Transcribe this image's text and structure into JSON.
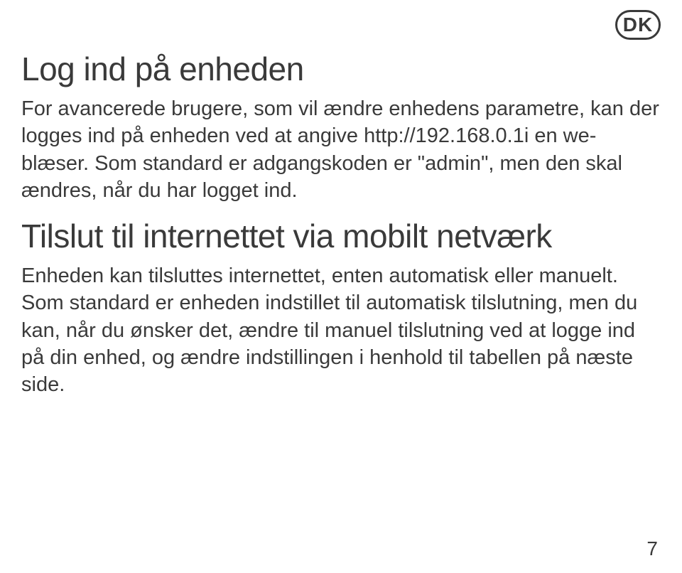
{
  "language_badge": "DK",
  "section1": {
    "title": "Log ind på enheden",
    "body": "For avancerede brugere, som vil ændre enhedens parametre, kan der logges ind på enheden ved at angive http://192.168.0.1i en we-blæser. Som standard er adgangskoden er \"admin\", men den skal ændres, når du har logget ind."
  },
  "section2": {
    "title": "Tilslut til internettet via mobilt netværk",
    "body": "Enheden kan tilsluttes internettet, enten automatisk eller manuelt. Som standard er enheden indstillet til automatisk tilslutning, men du kan, når du ønsker det, ændre til manuel tilslutning ved at logge ind på din enhed, og ændre indstillingen i henhold til tabellen på næste side."
  },
  "page_number": "7"
}
